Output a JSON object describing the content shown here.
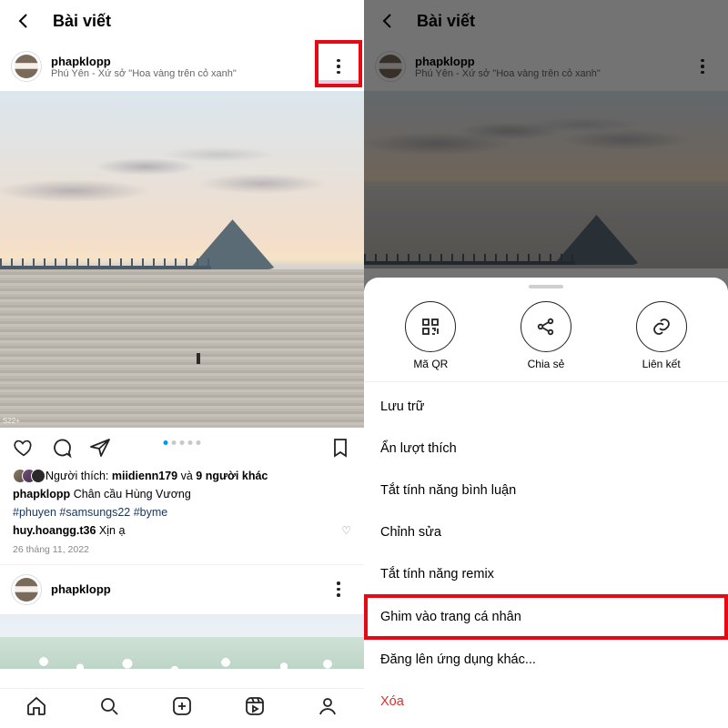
{
  "header": {
    "title": "Bài viết"
  },
  "post": {
    "username": "phapklopp",
    "location": "Phú Yên - Xứ sở \"Hoa vàng trên cỏ xanh\"",
    "stamp": "S22+"
  },
  "likes": {
    "prefix": "Người thích:",
    "liker": "miidienn179",
    "and": "và",
    "others": "9 người khác"
  },
  "caption": {
    "user": "phapklopp",
    "text": "Chân cầu Hùng Vương",
    "hashtags": "#phuyen #samsungs22 #byme"
  },
  "comment": {
    "user": "huy.hoangg.t36",
    "text": "Xịn ạ"
  },
  "timestamp": "26 tháng 11, 2022",
  "post2_user": "phapklopp",
  "sheet": {
    "qr": "Mã QR",
    "share": "Chia sẻ",
    "link": "Liên kết",
    "items": {
      "archive": "Lưu trữ",
      "hide_likes": "Ẩn lượt thích",
      "disable_comments": "Tắt tính năng bình luận",
      "edit": "Chỉnh sửa",
      "disable_remix": "Tắt tính năng remix",
      "pin": "Ghim vào trang cá nhân",
      "share_other": "Đăng lên ứng dụng khác...",
      "delete": "Xóa"
    }
  }
}
